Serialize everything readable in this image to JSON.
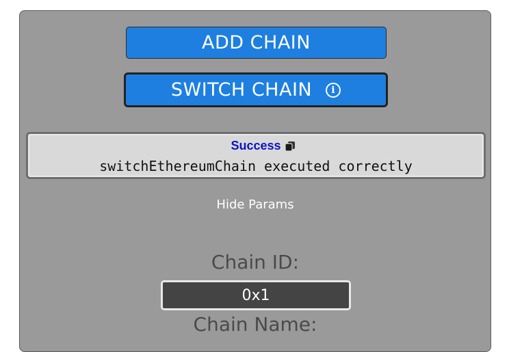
{
  "buttons": {
    "add_chain": "ADD CHAIN",
    "switch_chain": "SWITCH CHAIN",
    "info_glyph": "i"
  },
  "result": {
    "status": "Success",
    "message": "switchEthereumChain executed correctly",
    "copy_icon": "copy-icon"
  },
  "params": {
    "toggle_label": "Hide Params",
    "chain_id_label": "Chain ID:",
    "chain_id_value": "0x1",
    "chain_name_label": "Chain Name:"
  },
  "colors": {
    "panel_bg": "#9a9a9a",
    "button_bg": "#1e7fe0",
    "success_text": "#0a14c8",
    "field_bg": "#444444"
  }
}
